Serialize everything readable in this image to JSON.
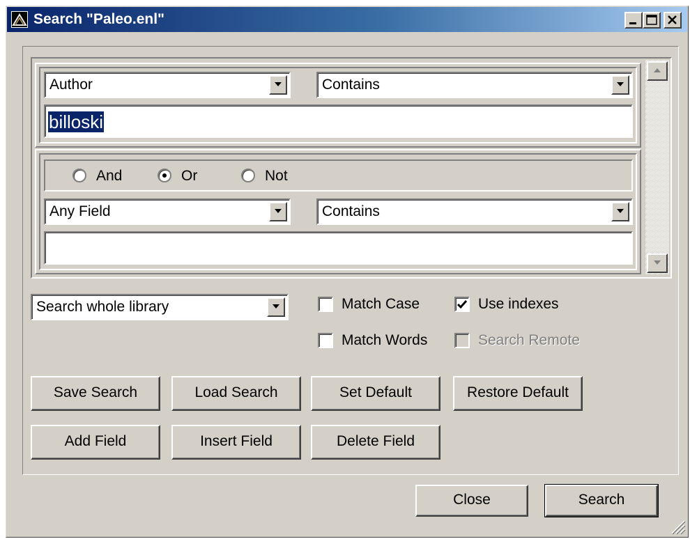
{
  "window": {
    "title": "Search \"Paleo.enl\"",
    "title_bar_color": "#0a246a",
    "face_color": "#d4d0c8",
    "icons": [
      "app-icon",
      "minimize-icon",
      "maximize-icon",
      "close-icon"
    ]
  },
  "criteria": [
    {
      "field": "Author",
      "operator": "Contains",
      "value": "billoski",
      "value_selected": true
    },
    {
      "logic": {
        "options": [
          "And",
          "Or",
          "Not"
        ],
        "selected": "Or"
      },
      "field": "Any Field",
      "operator": "Contains",
      "value": ""
    }
  ],
  "scope": {
    "selected": "Search whole library"
  },
  "options": {
    "match_case": {
      "label": "Match Case",
      "checked": false,
      "enabled": true
    },
    "use_indexes": {
      "label": "Use indexes",
      "checked": true,
      "enabled": true
    },
    "match_words": {
      "label": "Match Words",
      "checked": false,
      "enabled": true
    },
    "search_remote": {
      "label": "Search Remote",
      "checked": false,
      "enabled": false
    }
  },
  "buttons": {
    "save_search": "Save Search",
    "load_search": "Load Search",
    "set_default": "Set Default",
    "restore_default": "Restore Default",
    "add_field": "Add Field",
    "insert_field": "Insert Field",
    "delete_field": "Delete Field",
    "close": "Close",
    "search": "Search"
  }
}
